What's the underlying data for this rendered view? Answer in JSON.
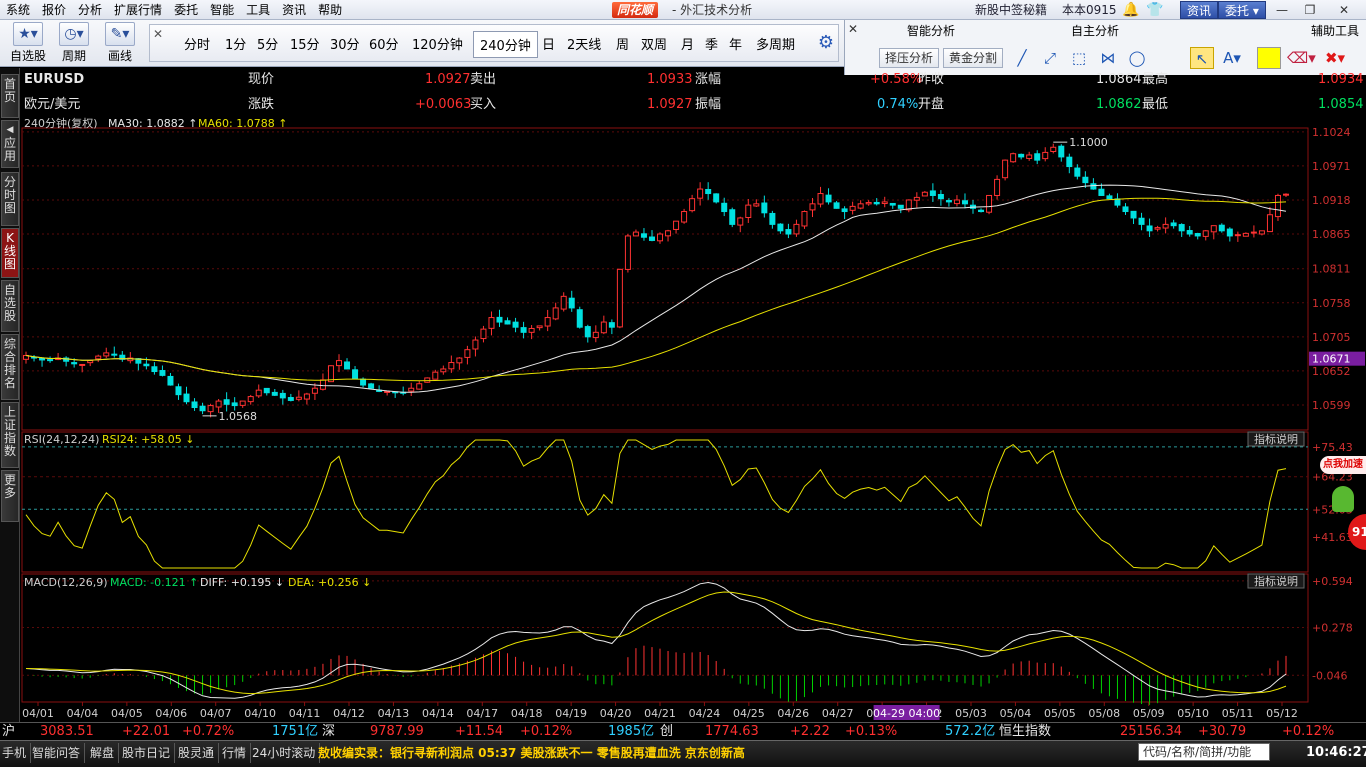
{
  "menu": {
    "items": [
      "系统",
      "报价",
      "分析",
      "扩展行情",
      "委托",
      "智能",
      "工具",
      "资讯",
      "帮助"
    ]
  },
  "app": {
    "brand": "同花顺",
    "title": "- 外汇技术分析"
  },
  "menu_right": {
    "news_link": "新股中签秘籍",
    "version": "本本0915",
    "zixun": "资讯",
    "weituo": "委托"
  },
  "toolbar": {
    "zixuangu": "自选股",
    "zhouqi": "周期",
    "huaxian": "画线"
  },
  "periods": [
    "分时",
    "1分",
    "5分",
    "15分",
    "30分",
    "60分",
    "120分钟",
    "240分钟",
    "日",
    "2天线",
    "周",
    "双周",
    "月",
    "季",
    "年",
    "多周期"
  ],
  "period_selected": "240分钟",
  "panel": {
    "ai_title": "智能分析",
    "self_title": "自主分析",
    "aux_title": "辅助工具",
    "btn_zeya": "择压分析",
    "btn_golden": "黄金分割"
  },
  "sidetabs": [
    {
      "label": "首页"
    },
    {
      "label": "应用"
    },
    {
      "label": "分时图"
    },
    {
      "label": "K线图"
    },
    {
      "label": "自选股"
    },
    {
      "label": "综合排名"
    },
    {
      "label": "上证指数"
    },
    {
      "label": "更多"
    }
  ],
  "quote": {
    "symbol": "EURUSD",
    "name": "欧元/美元",
    "l_xianjia": "现价",
    "v_xianjia": "1.0927",
    "l_zhangdie": "涨跌",
    "v_zhangdie": "+0.0063",
    "l_maichu": "卖出",
    "v_maichu": "1.0933",
    "l_mairu": "买入",
    "v_mairu": "1.0927",
    "l_zhangfu": "涨幅",
    "v_zhangfu": "+0.58%",
    "l_zhenfu": "振幅",
    "v_zhenfu": "0.74%",
    "l_zuoshou": "昨收",
    "v_zuoshou": "1.0864",
    "l_kaipan": "开盘",
    "v_kaipan": "1.0862",
    "l_zuigao": "最高",
    "v_zuigao": "1.0934",
    "l_zuidi": "最低",
    "v_zuidi": "1.0854"
  },
  "main_legend": {
    "period": "240分钟(复权)",
    "ma30": "MA30: 1.0882",
    "ma60": "MA60: 1.0788"
  },
  "rsi_legend": {
    "name": "RSI(24,12,24)",
    "rsi24": "RSI24: +58.05"
  },
  "macd_legend": {
    "name": "MACD(12,26,9)",
    "macd": "MACD: -0.121",
    "diff": "DIFF: +0.195",
    "dea": "DEA: +0.256"
  },
  "indicator_btn": "指标说明",
  "ad": {
    "badge": "点我加速",
    "ball": "91"
  },
  "bottom": {
    "sh_label": "沪",
    "sh_index": "3083.51",
    "sh_chg": "+22.01",
    "sh_pct": "+0.72%",
    "sh_amt": "1751亿",
    "sz_label": "深",
    "sz_index": "9787.99",
    "sz_chg": "+11.54",
    "sz_pct": "+0.12%",
    "sz_amt": "1985亿",
    "cy_label": "创",
    "cy_index": "1774.63",
    "cy_chg": "+2.22",
    "cy_pct": "+0.13%",
    "cy_amt": "572.2亿",
    "hs_label": "恒生指数",
    "hs_index": "25156.34",
    "hs_chg": "+30.79",
    "hs_pct": "+0.12%"
  },
  "statusbar": {
    "tabs": [
      "手机",
      "智能问答",
      "解盘",
      "股市日记",
      "股灵通",
      "行情",
      "24小时滚动"
    ],
    "ticker": "敖收编实录：银行寻新利润点      05:37 美股涨跌不一 零售股再遭血洗 京东创新高",
    "search": "代码/名称/简拼/功能",
    "time": "10:46:27"
  },
  "chart_data": {
    "type": "candlestick",
    "x_labels": [
      "04/01",
      "04/04",
      "04/05",
      "04/06",
      "04/07",
      "04/10",
      "04/11",
      "04/12",
      "04/13",
      "04/14",
      "04/17",
      "04/18",
      "04/19",
      "04/20",
      "04/21",
      "04/24",
      "04/25",
      "04/26",
      "04/27",
      "04/28",
      "05/02",
      "05/03",
      "05/04",
      "05/05",
      "05/08",
      "05/09",
      "05/10",
      "05/11",
      "05/12"
    ],
    "crosshair_time": "04-29 04:00",
    "price_axis": [
      "1.1024",
      "1.0971",
      "1.0918",
      "1.0865",
      "1.0811",
      "1.0758",
      "1.0705",
      "1.0652",
      "1.0599"
    ],
    "current_price": "1.0671",
    "ylim": [
      1.056,
      1.103
    ],
    "high_label": "1.1000",
    "low_label": "1.0568",
    "closes": [
      1.0676,
      1.0672,
      1.0669,
      1.0668,
      1.0672,
      1.0667,
      1.0663,
      1.0662,
      1.0668,
      1.0675,
      1.068,
      1.0678,
      1.067,
      1.0672,
      1.0664,
      1.066,
      1.0651,
      1.0645,
      1.063,
      1.0615,
      1.0604,
      1.0595,
      1.059,
      1.0598,
      1.0605,
      1.06,
      1.0598,
      1.0605,
      1.0612,
      1.0622,
      1.0618,
      1.0614,
      1.061,
      1.0606,
      1.0611,
      1.0616,
      1.0625,
      1.0638,
      1.066,
      1.0668,
      1.0655,
      1.064,
      1.063,
      1.0625,
      1.062,
      1.062,
      1.0619,
      1.0618,
      1.0625,
      1.0632,
      1.0641,
      1.065,
      1.0655,
      1.0665,
      1.0672,
      1.0685,
      1.07,
      1.0717,
      1.0735,
      1.0728,
      1.0725,
      1.072,
      1.0712,
      1.0718,
      1.0722,
      1.0735,
      1.075,
      1.0768,
      1.075,
      1.072,
      1.0705,
      1.0712,
      1.0728,
      1.072,
      1.081,
      1.0862,
      1.0868,
      1.086,
      1.0855,
      1.0865,
      1.087,
      1.0885,
      1.09,
      1.092,
      1.0935,
      1.0928,
      1.0915,
      1.09,
      1.088,
      1.089,
      1.091,
      1.0912,
      1.0898,
      1.088,
      1.087,
      1.0865,
      1.088,
      1.09,
      1.0912,
      1.0928,
      1.0915,
      1.0905,
      1.09,
      1.0908,
      1.0912,
      1.0914,
      1.0912,
      1.0915,
      1.091,
      1.0905,
      1.0918,
      1.0922,
      1.093,
      1.0925,
      1.092,
      1.0915,
      1.0918,
      1.0912,
      1.0905,
      1.09,
      1.0925,
      1.095,
      1.098,
      1.099,
      1.0985,
      1.0988,
      1.098,
      1.0992,
      1.1,
      1.0985,
      1.097,
      1.0955,
      1.0945,
      1.0935,
      1.0925,
      1.092,
      1.091,
      1.09,
      1.089,
      1.088,
      1.087,
      1.0875,
      1.088,
      1.0878,
      1.087,
      1.0865,
      1.0862,
      1.087,
      1.0878,
      1.087,
      1.0862,
      1.0864,
      1.0866,
      1.0868,
      1.087,
      1.0895,
      1.0925,
      1.0927
    ]
  }
}
